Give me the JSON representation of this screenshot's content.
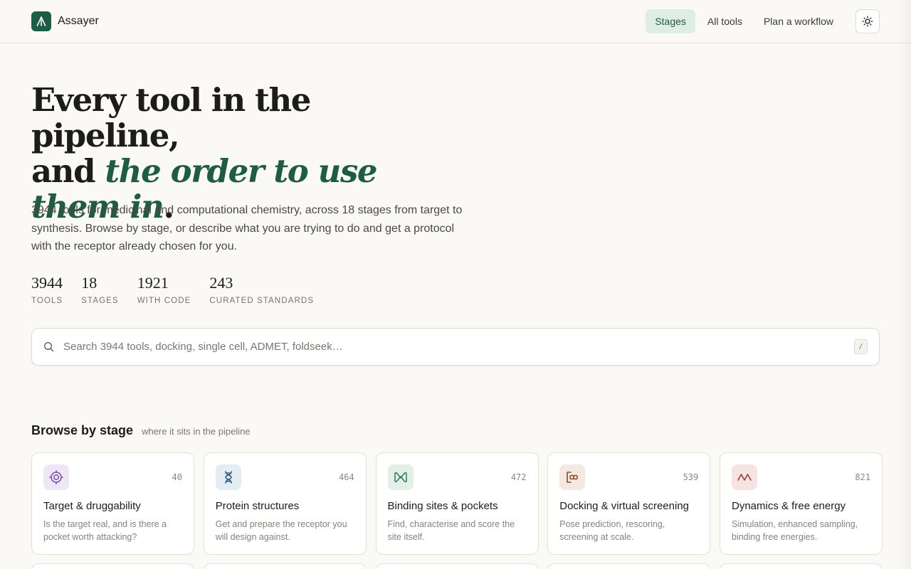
{
  "app": {
    "name": "Assayer"
  },
  "nav": {
    "items": [
      {
        "label": "Stages"
      },
      {
        "label": "All tools"
      },
      {
        "label": "Plan a workflow"
      }
    ]
  },
  "hero": {
    "title_line1": "Every tool in the pipeline,",
    "title_line2_prefix": "and ",
    "title_emphasis": "the order to use them in",
    "title_suffix": ".",
    "description": "3944 tools for medicinal and computational chemistry, across 18 stages from target to synthesis. Browse by stage, or describe what you are trying to do and get a protocol with the receptor already chosen for you."
  },
  "stats": [
    {
      "value": "3944",
      "label": "TOOLS"
    },
    {
      "value": "18",
      "label": "STAGES"
    },
    {
      "value": "1921",
      "label": "WITH CODE"
    },
    {
      "value": "243",
      "label": "CURATED STANDARDS"
    }
  ],
  "search": {
    "placeholder": "Search 3944 tools, docking, single cell, ADMET, foldseek…",
    "shortcut": "/"
  },
  "browse": {
    "title": "Browse by stage",
    "subtitle": "where it sits in the pipeline"
  },
  "stages": [
    {
      "icon": "target-icon",
      "count": "40",
      "title": "Target & druggability",
      "desc": "Is the target real, and is there a pocket worth attacking?",
      "accent": "#7a4fa8",
      "bg": "#efe7f6"
    },
    {
      "icon": "dna-icon",
      "count": "464",
      "title": "Protein structures",
      "desc": "Get and prepare the receptor you will design against.",
      "accent": "#2f5d85",
      "bg": "#e5edf4"
    },
    {
      "icon": "pocket-icon",
      "count": "472",
      "title": "Binding sites & pockets",
      "desc": "Find, characterise and score the site itself.",
      "accent": "#2a7a57",
      "bg": "#e2f0e8"
    },
    {
      "icon": "docking-icon",
      "count": "539",
      "title": "Docking & virtual screening",
      "desc": "Pose prediction, rescoring, screening at scale.",
      "accent": "#8a4a2c",
      "bg": "#f4e8e1"
    },
    {
      "icon": "wave-icon",
      "count": "821",
      "title": "Dynamics & free energy",
      "desc": "Simulation, enhanced sampling, binding free energies.",
      "accent": "#9a3f3a",
      "bg": "#f5e4e2"
    }
  ]
}
